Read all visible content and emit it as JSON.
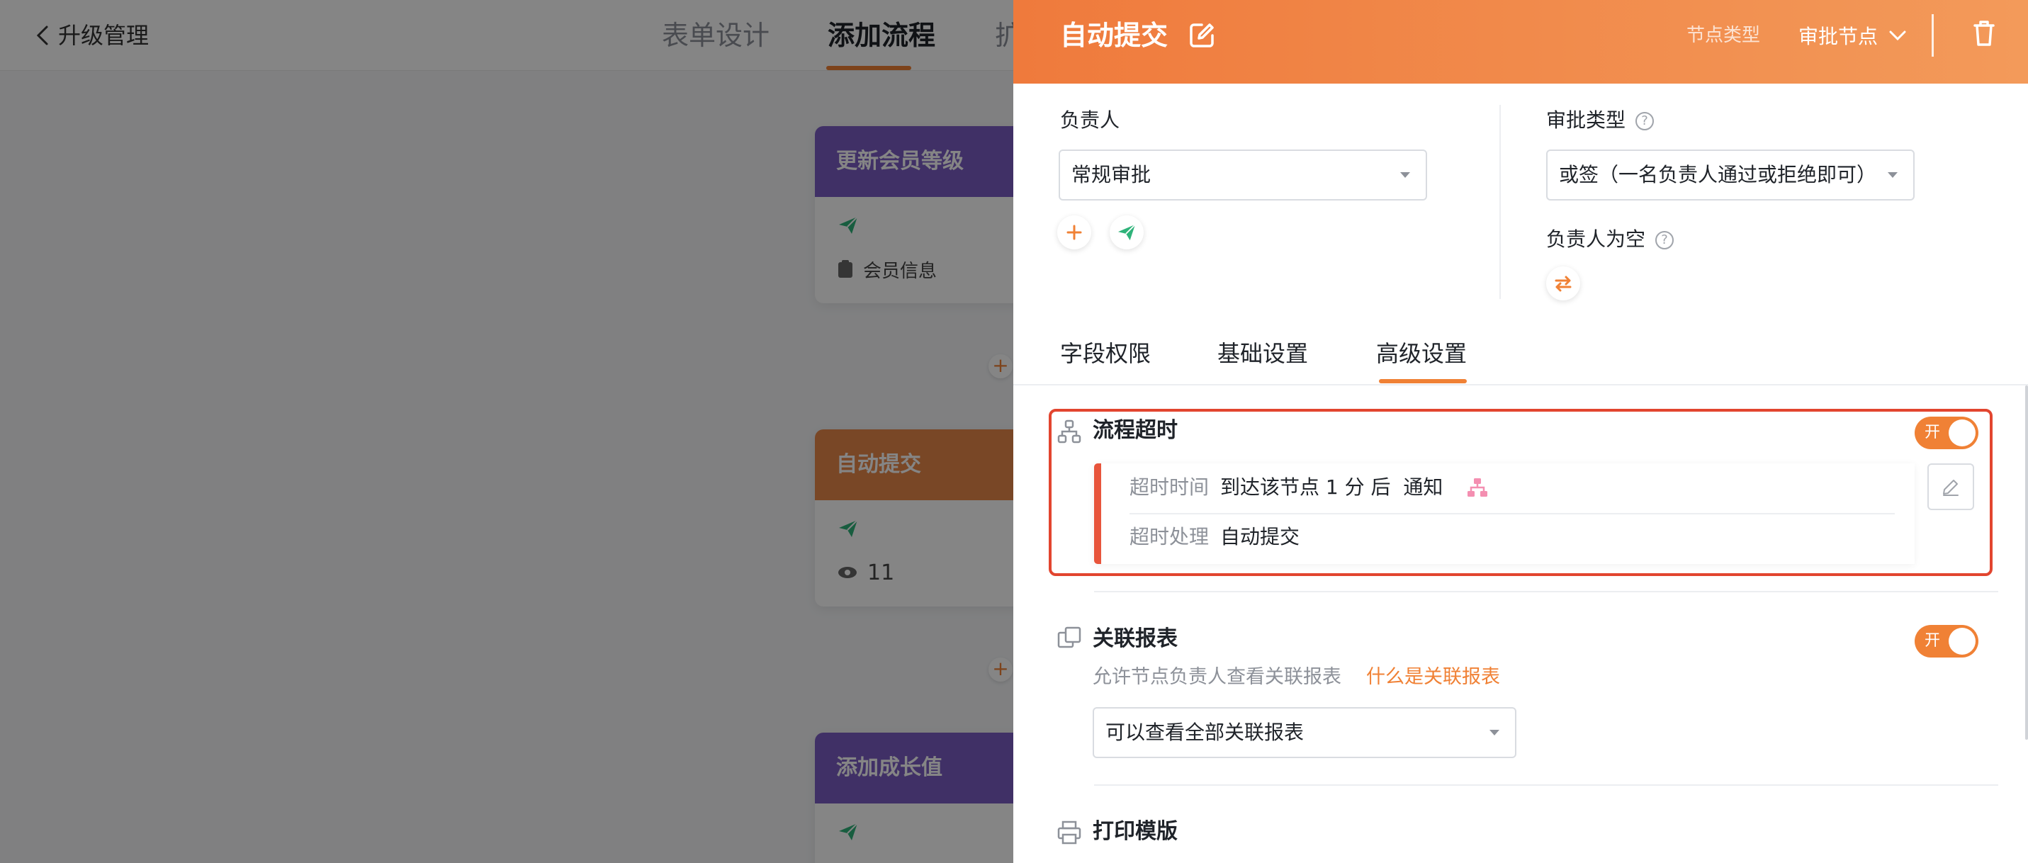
{
  "app": {
    "back_label": "升级管理",
    "top_tabs": [
      "表单设计",
      "添加流程",
      "扩"
    ]
  },
  "flow_cards": [
    {
      "title": "更新会员等级",
      "color": "#7b5cc4",
      "info": "会员信息"
    },
    {
      "title": "自动提交",
      "color": "#e8884a",
      "info": "11"
    },
    {
      "title": "添加成长值",
      "color": "#7b5cc4",
      "info": ""
    }
  ],
  "drawer": {
    "title": "自动提交",
    "node_type_label": "节点类型",
    "node_type_value": "审批节点",
    "assignee": {
      "label": "负责人",
      "value": "常规审批"
    },
    "approval_type": {
      "label": "审批类型",
      "help": "?",
      "value": "或签（一名负责人通过或拒绝即可）"
    },
    "empty_assignee": {
      "label": "负责人为空",
      "help": "?"
    },
    "tabs": [
      "字段权限",
      "基础设置",
      "高级设置"
    ],
    "timeout": {
      "title": "流程超时",
      "toggle": "开",
      "time_key": "超时时间",
      "time_value": "到达该节点 1 分 后  通知",
      "handle_key": "超时处理",
      "handle_value": "自动提交"
    },
    "linked_report": {
      "title": "关联报表",
      "toggle": "开",
      "desc": "允许节点负责人查看关联报表",
      "link": "什么是关联报表",
      "select_value": "可以查看全部关联报表"
    },
    "print": {
      "title": "打印模版"
    }
  },
  "colors": {
    "accent": "#f08135",
    "highlight": "#e2452f",
    "send_icon": "#2fb37a"
  }
}
